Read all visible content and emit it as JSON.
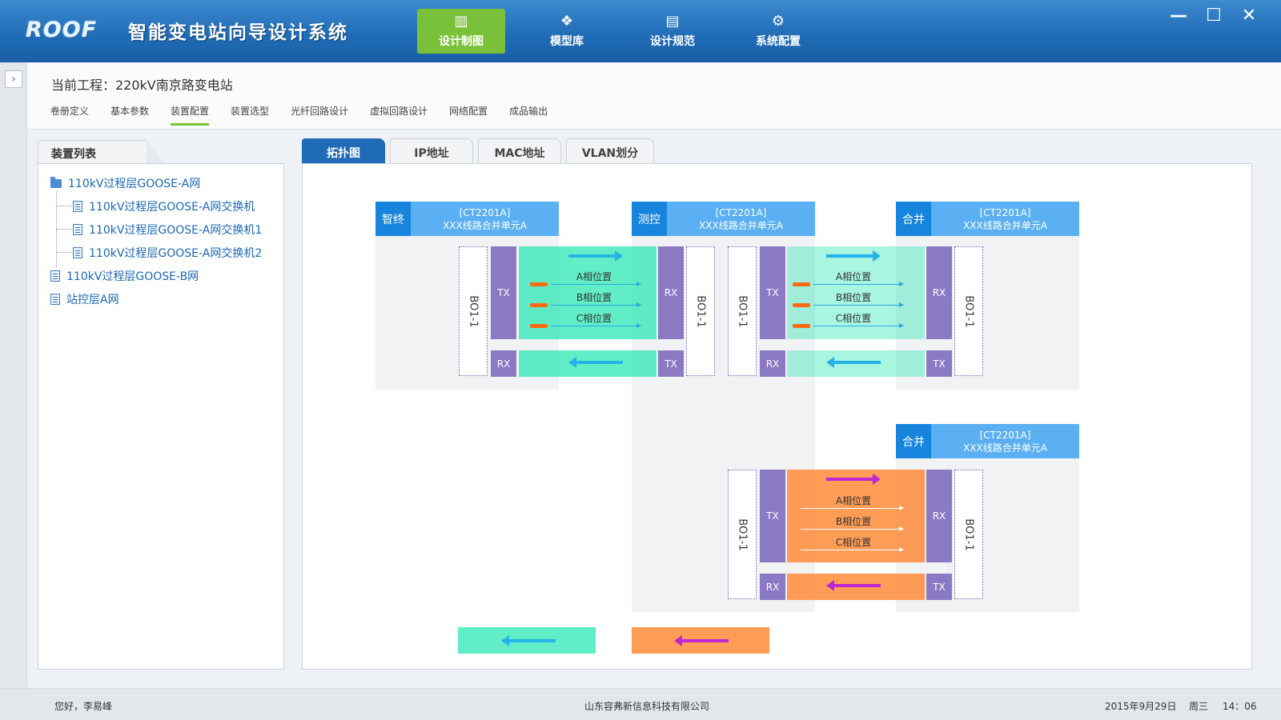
{
  "app": {
    "logo": "ROOF",
    "title": "智能变电站向导设计系统"
  },
  "nav": [
    {
      "icon": "design-drawing-icon",
      "glyph": "▥",
      "label": "设计制图",
      "active": true
    },
    {
      "icon": "model-library-icon",
      "glyph": "❖",
      "label": "模型库"
    },
    {
      "icon": "design-spec-icon",
      "glyph": "▤",
      "label": "设计规范"
    },
    {
      "icon": "system-config-icon",
      "glyph": "⚙",
      "label": "系统配置"
    }
  ],
  "window": {
    "minimize": "—",
    "maximize": "☐",
    "close": "✕"
  },
  "expand_glyph": "›",
  "project": {
    "title": "当前工程：220kV南京路变电站"
  },
  "subtabs": [
    "卷册定义",
    "基本参数",
    "装置配置",
    "装置选型",
    "光纤回路设计",
    "虚拟回路设计",
    "网络配置",
    "成品输出"
  ],
  "subtab_active": "装置配置",
  "device_list": {
    "title": "装置列表",
    "items": [
      {
        "label": "110kV过程层GOOSE-A网",
        "level": 0,
        "icon": "folder-icon"
      },
      {
        "label": "110kV过程层GOOSE-A网交换机",
        "level": 1,
        "icon": "document-icon"
      },
      {
        "label": "110kV过程层GOOSE-A网交换机1",
        "level": 1,
        "icon": "document-icon"
      },
      {
        "label": "110kV过程层GOOSE-A网交换机2",
        "level": 1,
        "icon": "document-icon"
      },
      {
        "label": "110kV过程层GOOSE-B网",
        "level": 0,
        "icon": "document-icon"
      },
      {
        "label": "站控层A网",
        "level": 0,
        "icon": "document-icon"
      }
    ]
  },
  "view_tabs": [
    "拓扑图",
    "IP地址",
    "MAC地址",
    "VLAN划分"
  ],
  "view_tab_active": "拓扑图",
  "topology": {
    "devices": [
      {
        "tag": "智终",
        "code": "[CT2201A]",
        "name": "XXX线路合并单元A"
      },
      {
        "tag": "测控",
        "code": "[CT2201A]",
        "name": "XXX线路合并单元A"
      },
      {
        "tag": "合并",
        "code": "[CT2201A]",
        "name": "XXX线路合并单元A"
      },
      {
        "tag": "合并",
        "code": "[CT2201A]",
        "name": "XXX线路合并单元A"
      }
    ],
    "board": "BO1-1",
    "ports": {
      "tx": "TX",
      "rx": "RX"
    },
    "phases": [
      "A相位置",
      "B相位置",
      "C相位置"
    ],
    "colors": {
      "cyan_link": "#34e8b6",
      "orange_link": "#ff8c3a",
      "port": "#8b79c5",
      "device_tag": "#1785dd",
      "device_head": "#5ab0f2"
    }
  },
  "status": {
    "greeting": "您好，李易峰",
    "company": "山东容弗新信息科技有限公司",
    "date": "2015年9月29日",
    "weekday": "周三",
    "time": "14：06"
  }
}
